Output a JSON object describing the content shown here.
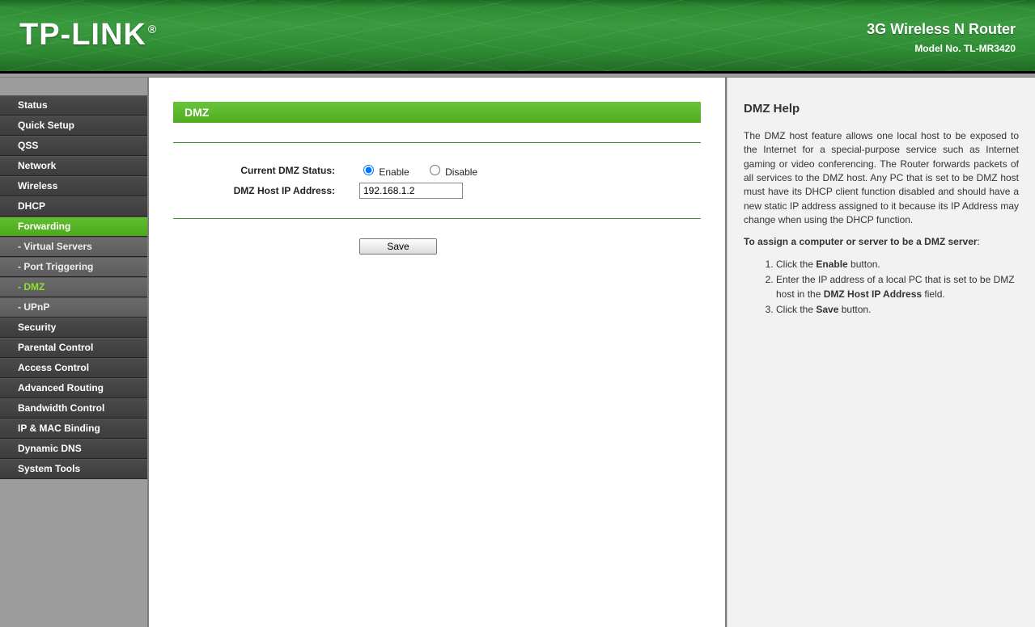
{
  "header": {
    "logo_text": "TP-LINK",
    "product_name": "3G Wireless N Router",
    "model_no": "Model No. TL-MR3420"
  },
  "sidebar": {
    "items": [
      {
        "label": "Status",
        "active": false
      },
      {
        "label": "Quick Setup",
        "active": false
      },
      {
        "label": "QSS",
        "active": false
      },
      {
        "label": "Network",
        "active": false
      },
      {
        "label": "Wireless",
        "active": false
      },
      {
        "label": "DHCP",
        "active": false
      },
      {
        "label": "Forwarding",
        "active": true,
        "children": [
          {
            "label": "Virtual Servers",
            "active": false
          },
          {
            "label": "Port Triggering",
            "active": false
          },
          {
            "label": "DMZ",
            "active": true
          },
          {
            "label": "UPnP",
            "active": false
          }
        ]
      },
      {
        "label": "Security",
        "active": false
      },
      {
        "label": "Parental Control",
        "active": false
      },
      {
        "label": "Access Control",
        "active": false
      },
      {
        "label": "Advanced Routing",
        "active": false
      },
      {
        "label": "Bandwidth Control",
        "active": false
      },
      {
        "label": "IP & MAC Binding",
        "active": false
      },
      {
        "label": "Dynamic DNS",
        "active": false
      },
      {
        "label": "System Tools",
        "active": false
      }
    ]
  },
  "main": {
    "page_title": "DMZ",
    "status_label": "Current DMZ Status:",
    "enable_label": "Enable",
    "disable_label": "Disable",
    "status_value": "enable",
    "ip_label": "DMZ Host IP Address:",
    "ip_value": "192.168.1.2",
    "save_label": "Save"
  },
  "help": {
    "title": "DMZ Help",
    "intro": "The DMZ host feature allows one local host to be exposed to the Internet for a special-purpose service such as Internet gaming or video conferencing. The Router forwards packets of all services to the DMZ host. Any PC that is set to be DMZ host must have its DHCP client function disabled and should have a new static IP address assigned to it because its IP Address may change when using the DHCP function.",
    "assign_heading": "To assign a computer or server to be a DMZ server",
    "step1_pre": "Click the ",
    "step1_bold": "Enable",
    "step1_post": " button.",
    "step2_pre": "Enter the IP address of a local PC that is set to be DMZ host in the ",
    "step2_bold": "DMZ Host IP Address",
    "step2_post": " field.",
    "step3_pre": "Click the ",
    "step3_bold": "Save",
    "step3_post": " button."
  }
}
